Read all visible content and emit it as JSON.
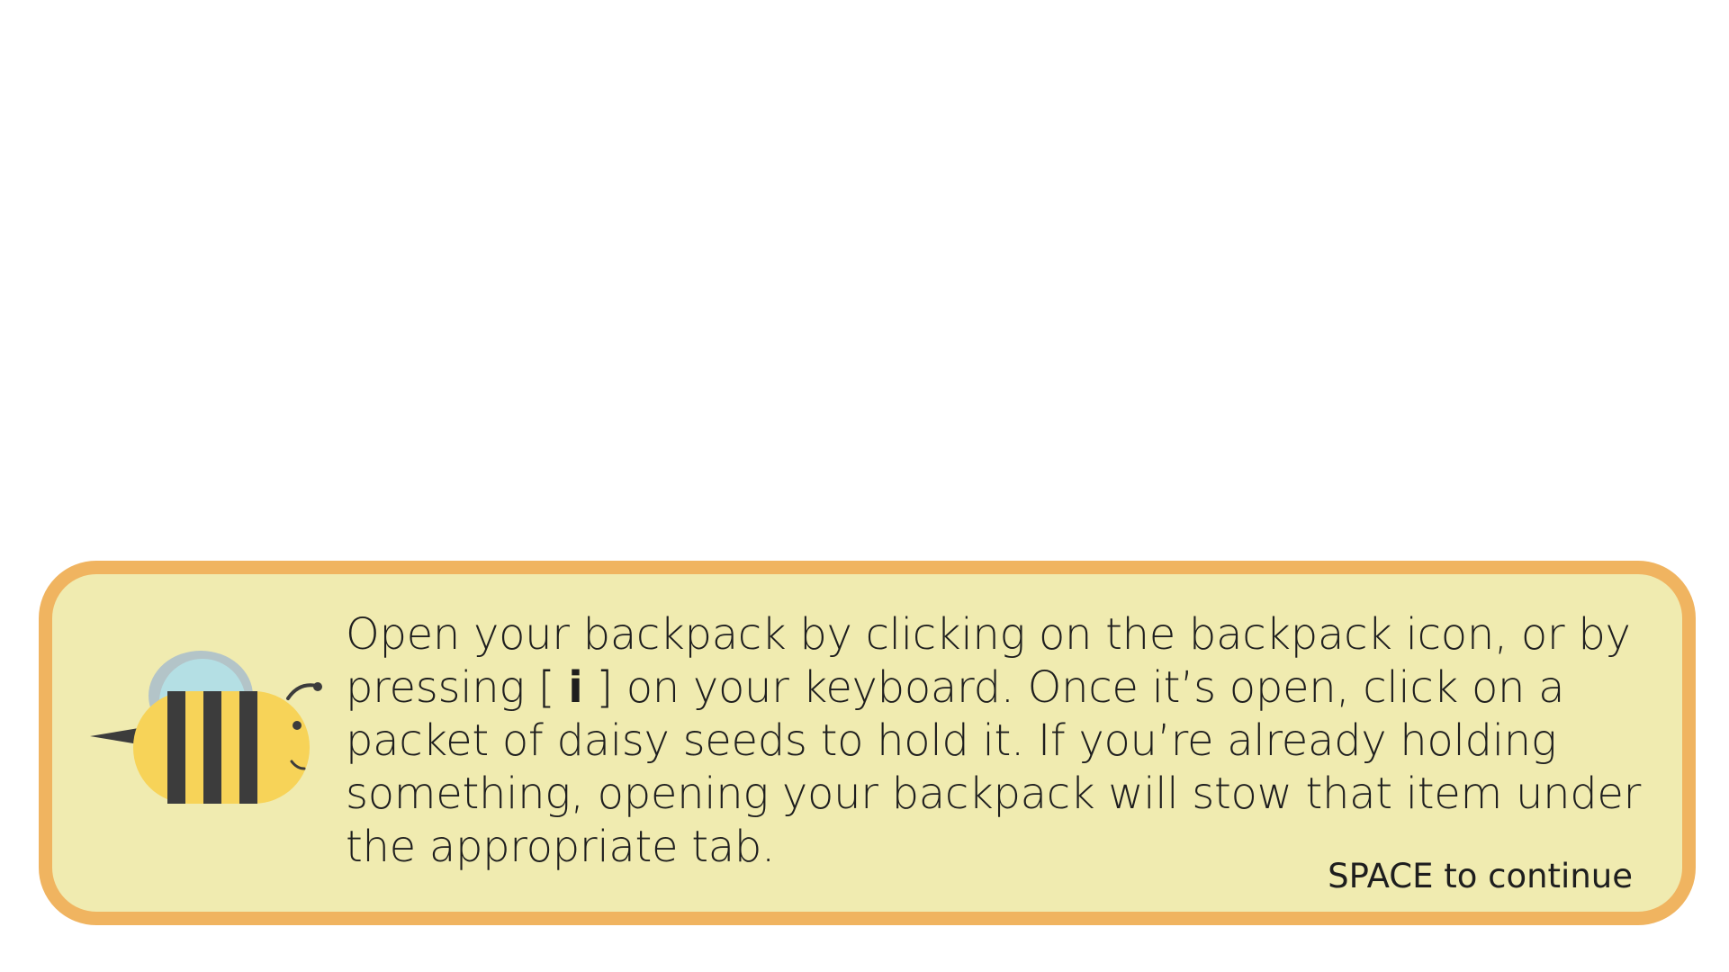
{
  "dialog": {
    "text_before_key": "Open your backpack by clicking on the backpack icon, or by pressing [ ",
    "key": "i",
    "text_after_key": " ] on your keyboard. Once it’s open, click on a packet of daisy seeds to hold it. If you’re already holding something, opening your backpack will stow that item under the appropriate tab.",
    "continue_hint": "SPACE to continue",
    "speaker_icon": "bee-icon"
  },
  "colors": {
    "panel_fill": "#f0ebb0",
    "panel_border": "#f0b460",
    "bee_body": "#f7d358",
    "bee_stripe": "#3c3c3c",
    "bee_wing": "#b4dfe4",
    "bee_wing_back": "#b3c4c8"
  }
}
